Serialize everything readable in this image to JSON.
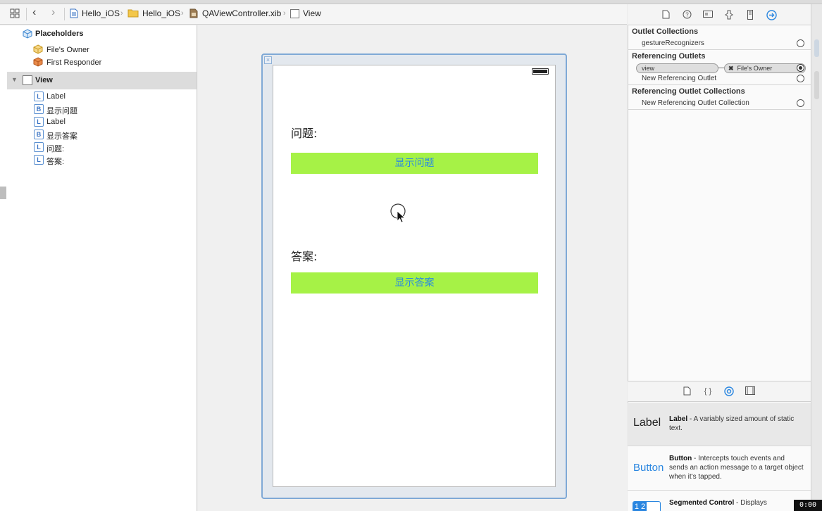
{
  "jumpbar": {
    "crumbs": [
      "Hello_iOS",
      "Hello_iOS",
      "QAViewController.xib",
      "View"
    ]
  },
  "outline": {
    "placeholders_label": "Placeholders",
    "files_owner": "File's Owner",
    "first_responder": "First Responder",
    "view_label": "View",
    "children": [
      {
        "badge": "L",
        "label": "Label"
      },
      {
        "badge": "B",
        "label": "显示问题"
      },
      {
        "badge": "L",
        "label": "Label"
      },
      {
        "badge": "B",
        "label": "显示答案"
      },
      {
        "badge": "L",
        "label": "问题:"
      },
      {
        "badge": "L",
        "label": "答案:"
      }
    ]
  },
  "canvas": {
    "question_label": "问题:",
    "question_button": "显示问题",
    "answer_label": "答案:",
    "answer_button": "显示答案",
    "button_color": "#a6f246",
    "button_text_color": "#2a8be0"
  },
  "inspector": {
    "outlet_collections_title": "Outlet Collections",
    "gesture_recognizers": "gestureRecognizers",
    "referencing_outlets_title": "Referencing Outlets",
    "view_outlet": "view",
    "connected_to": "File's Owner",
    "new_referencing_outlet": "New Referencing Outlet",
    "referencing_outlet_collections_title": "Referencing Outlet Collections",
    "new_referencing_outlet_collection": "New Referencing Outlet Collection"
  },
  "library": {
    "items": [
      {
        "icon": "Label",
        "name": "Label",
        "desc": " - A variably sized amount of static text."
      },
      {
        "icon": "Button",
        "name": "Button",
        "desc": " - Intercepts touch events and sends an action message to a target object when it's tapped."
      },
      {
        "icon": "1 2",
        "name": "Segmented Control",
        "desc": " - Displays"
      }
    ]
  },
  "timer": "0:00"
}
